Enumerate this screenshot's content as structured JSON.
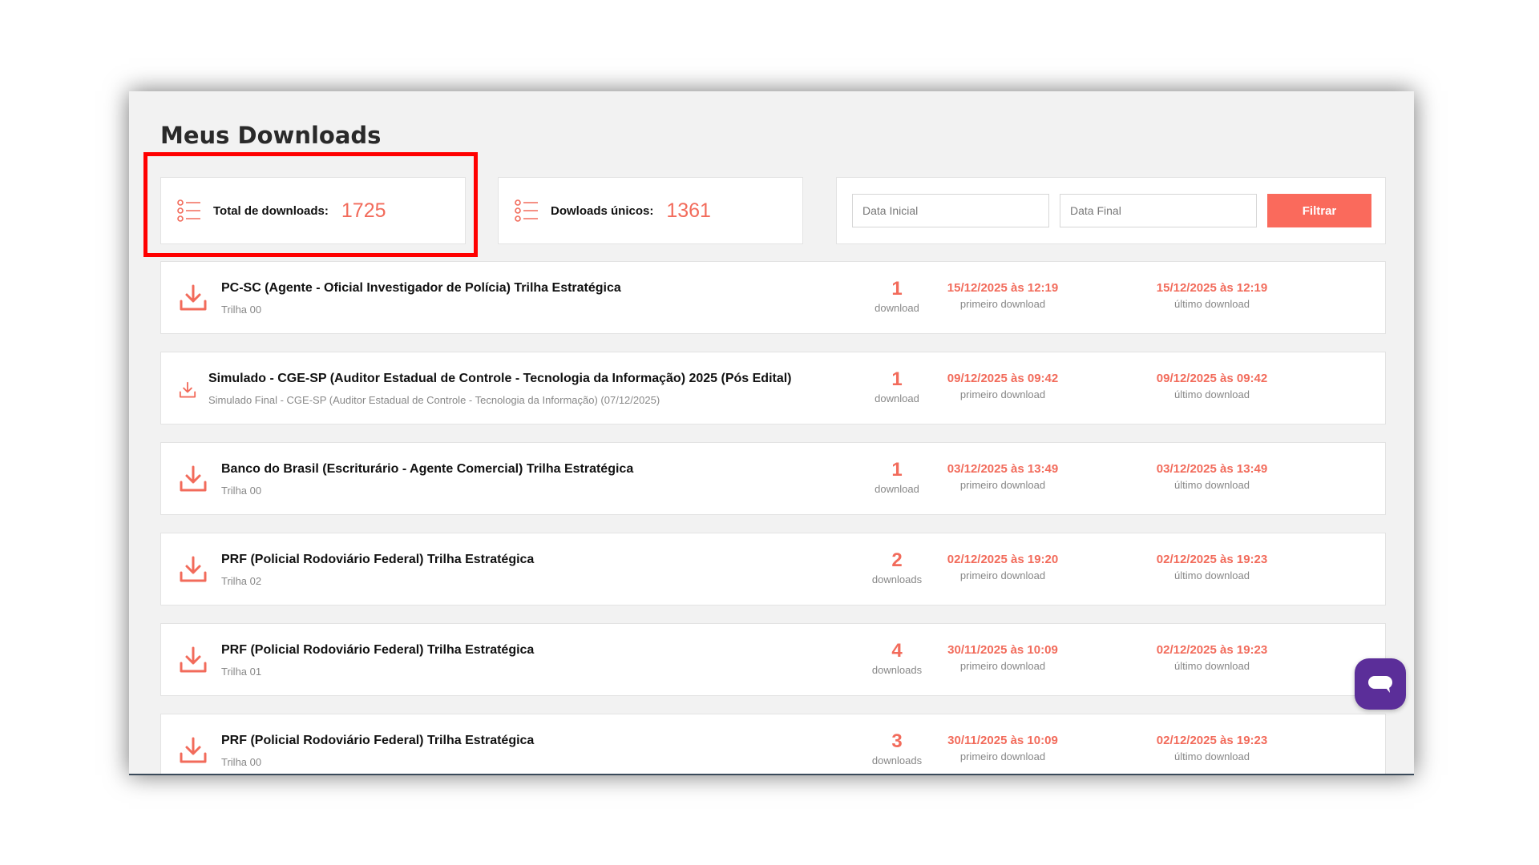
{
  "page": {
    "title": "Meus Downloads"
  },
  "stats": {
    "total_label": "Total de downloads:",
    "total_value": "1725",
    "unique_label": "Dowloads únicos:",
    "unique_value": "1361"
  },
  "filter": {
    "start_placeholder": "Data Inicial",
    "end_placeholder": "Data Final",
    "button_label": "Filtrar"
  },
  "labels": {
    "first_download": "primeiro download",
    "last_download": "último download"
  },
  "rows": [
    {
      "title": "PC-SC (Agente - Oficial Investigador de Polícia) Trilha Estratégica",
      "subtitle": "Trilha 00",
      "count": "1",
      "count_label": "download",
      "first": "15/12/2025 às 12:19",
      "last": "15/12/2025 às 12:19"
    },
    {
      "title": "Simulado - CGE-SP (Auditor Estadual de Controle - Tecnologia da Informação) 2025 (Pós Edital)",
      "subtitle": "Simulado Final - CGE-SP (Auditor Estadual de Controle - Tecnologia da Informação) (07/12/2025)",
      "count": "1",
      "count_label": "download",
      "first": "09/12/2025 às 09:42",
      "last": "09/12/2025 às 09:42"
    },
    {
      "title": "Banco do Brasil (Escriturário - Agente Comercial) Trilha Estratégica",
      "subtitle": "Trilha 00",
      "count": "1",
      "count_label": "download",
      "first": "03/12/2025 às 13:49",
      "last": "03/12/2025 às 13:49"
    },
    {
      "title": "PRF (Policial Rodoviário Federal) Trilha Estratégica",
      "subtitle": "Trilha 02",
      "count": "2",
      "count_label": "downloads",
      "first": "02/12/2025 às 19:20",
      "last": "02/12/2025 às 19:23"
    },
    {
      "title": "PRF (Policial Rodoviário Federal) Trilha Estratégica",
      "subtitle": "Trilha 01",
      "count": "4",
      "count_label": "downloads",
      "first": "30/11/2025 às 10:09",
      "last": "02/12/2025 às 19:23"
    },
    {
      "title": "PRF (Policial Rodoviário Federal) Trilha Estratégica",
      "subtitle": "Trilha 00",
      "count": "3",
      "count_label": "downloads",
      "first": "30/11/2025 às 10:09",
      "last": "02/12/2025 às 19:23"
    }
  ],
  "icons": {
    "stat": "list-icon",
    "row": "download-icon",
    "chat": "chat-bubble-icon"
  },
  "colors": {
    "accent": "#f26b5b",
    "button": "#fa6a5c",
    "highlight": "#ff0000",
    "chat": "#5b2e99"
  }
}
